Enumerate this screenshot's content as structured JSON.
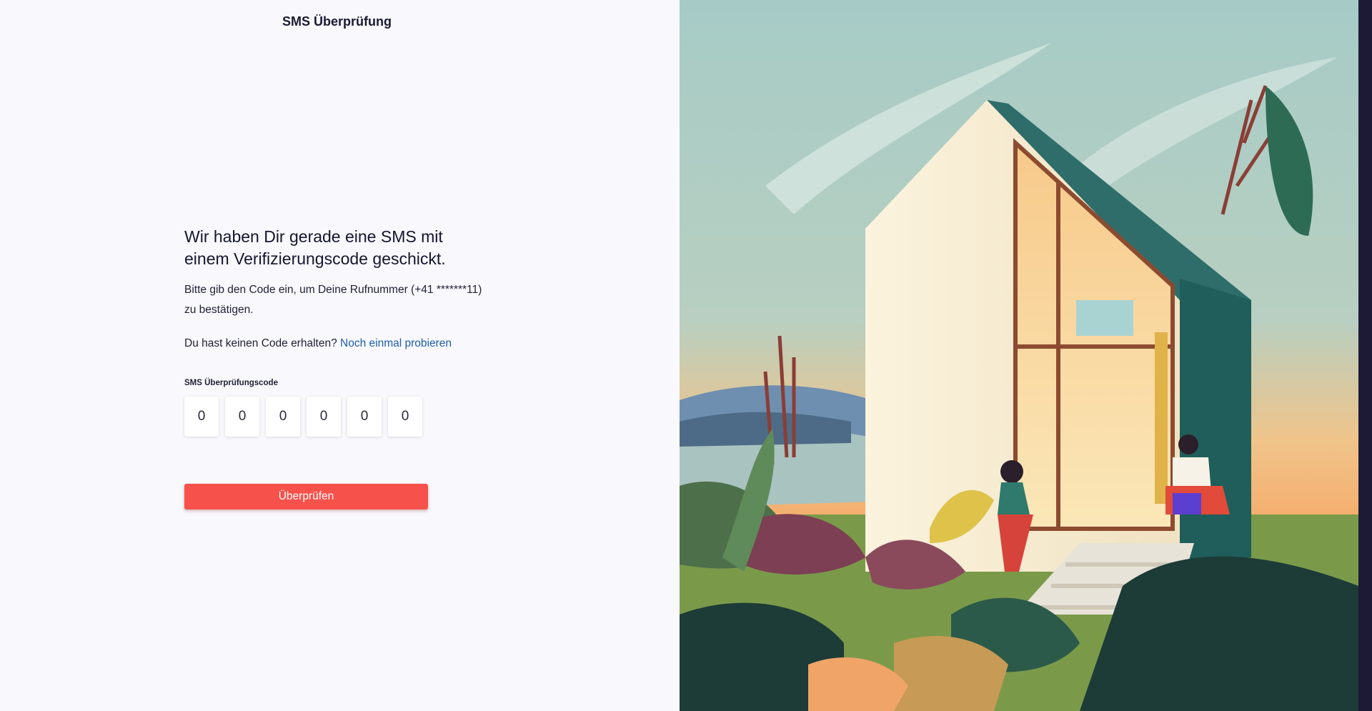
{
  "page": {
    "title": "SMS Überprüfung"
  },
  "form": {
    "heading_line1": "Wir haben Dir gerade eine SMS mit",
    "heading_line2": "einem Verifizierungscode geschickt.",
    "desc_line1": "Bitte gib den Code ein, um Deine Rufnummer (+41 *******11)",
    "desc_line2": "zu bestätigen.",
    "retry_text": "Du hast keinen Code erhalten?",
    "retry_link": "Noch einmal probieren",
    "code_label": "SMS Überprüfungscode",
    "digits": [
      "0",
      "0",
      "0",
      "0",
      "0",
      "0"
    ],
    "submit_label": "Überprüfen"
  },
  "colors": {
    "primary_button": "#f7514b",
    "link": "#1d5fa8",
    "background": "#f8f8fd"
  },
  "illustration": {
    "icon": "house-illustration"
  }
}
